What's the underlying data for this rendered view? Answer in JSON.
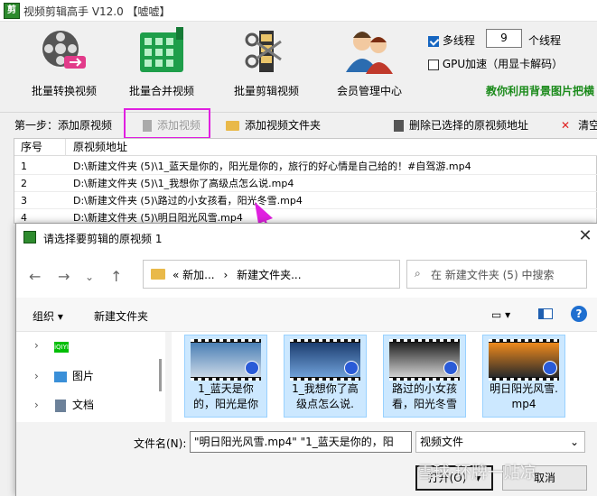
{
  "window": {
    "title": "视频剪辑高手 V12.0  【嘘嘘】"
  },
  "toolbar": {
    "batch_convert": "批量转换视频",
    "batch_merge": "批量合并视频",
    "batch_edit": "批量剪辑视频",
    "member_center": "会员管理中心",
    "multithread_label": "多线程",
    "multithread_checked": true,
    "threads_value": "9",
    "threads_suffix": "个线程",
    "gpu_label": "GPU加速（用显卡解码）",
    "gpu_checked": false,
    "promo": "教你利用背景图片把横"
  },
  "step_bar": {
    "step_label": "第一步：添加原视频",
    "add_video": "添加视频",
    "add_folder": "添加视频文件夹",
    "delete_selected": "删除已选择的原视频地址",
    "clear": "清空"
  },
  "table": {
    "headers": [
      "序号",
      "原视频地址"
    ],
    "rows": [
      {
        "index": "1",
        "path": "D:\\新建文件夹 (5)\\1_蓝天是你的，阳光是你的，旅行的好心情是自己给的！#自驾游.mp4"
      },
      {
        "index": "2",
        "path": "D:\\新建文件夹 (5)\\1_我想你了高级点怎么说.mp4"
      },
      {
        "index": "3",
        "path": "D:\\新建文件夹 (5)\\路过的小女孩看，阳光冬雪.mp4"
      },
      {
        "index": "4",
        "path": "D:\\新建文件夹 (5)\\明日阳光风雪.mp4"
      }
    ]
  },
  "dialog": {
    "title": "请选择要剪辑的原视频 1",
    "address_parts": [
      "«",
      "新加...",
      "›",
      "新建文件夹..."
    ],
    "search_placeholder": "在 新建文件夹 (5) 中搜索",
    "organize": "组织 ▾",
    "new_folder": "新建文件夹",
    "nav_items": [
      {
        "label": "iQIYI",
        "icon": "iqiyi-icon"
      },
      {
        "label": "图片",
        "icon": "pictures-icon"
      },
      {
        "label": "文档",
        "icon": "documents-icon"
      }
    ],
    "files": [
      {
        "name": "1_蓝天是你的，阳光是你",
        "colors": [
          "#4a7fb5",
          "#c9d7e6"
        ]
      },
      {
        "name": "1_我想你了高级点怎么说.",
        "colors": [
          "#1d3e70",
          "#6fa0d8"
        ]
      },
      {
        "name": "路过的小女孩看，阳光冬雪",
        "colors": [
          "#222222",
          "#d0d0d0"
        ]
      },
      {
        "name": "明日阳光风雪.mp4",
        "colors": [
          "#f08a1c",
          "#2a2a2a"
        ]
      }
    ],
    "filename_label": "文件名(N):",
    "filename_value": "\"明日阳光风雪.mp4\" \"1_蓝天是你的，阳",
    "filetype": "视频文件",
    "open": "打开(O)",
    "cancel": "取消"
  },
  "watermark": "雪球·环牌一贴凉"
}
